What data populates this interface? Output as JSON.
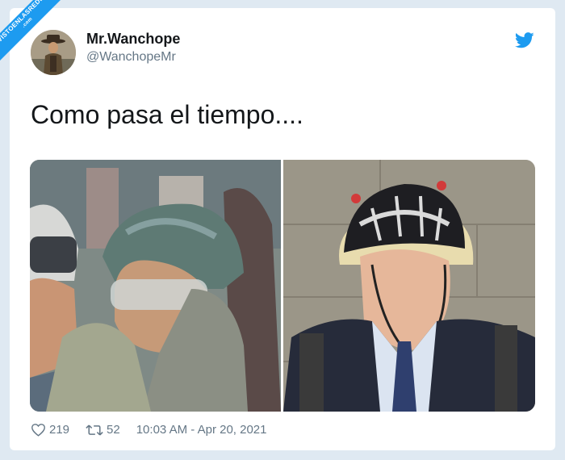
{
  "watermark": {
    "line1": "VISTOENLASREDES",
    "line2": ".com"
  },
  "tweet": {
    "display_name": "Mr.Wanchope",
    "handle": "@WanchopeMr",
    "text": "Como pasa el tiempo....",
    "likes": "219",
    "retweets": "52",
    "timestamp": "10:03 AM - Apr 20, 2021"
  },
  "icons": {
    "logo": "twitter-bird-icon",
    "like": "heart-icon",
    "retweet": "retweet-icon"
  },
  "colors": {
    "accent": "#1d9bf0",
    "text": "#14171a",
    "muted": "#657786",
    "background": "#dfe9f2"
  }
}
